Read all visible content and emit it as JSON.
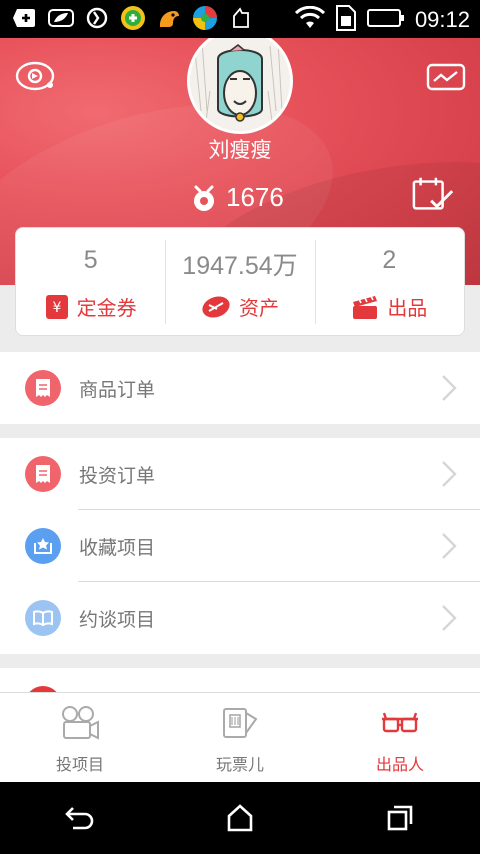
{
  "status_bar": {
    "time": "09:12"
  },
  "profile": {
    "username": "刘瘦瘦",
    "coins": "1676"
  },
  "stats": [
    {
      "value": "5",
      "label": "定金券",
      "icon": "coupon-icon"
    },
    {
      "value": "1947.54万",
      "label": "资产",
      "icon": "assets-icon"
    },
    {
      "value": "2",
      "label": "出品",
      "icon": "clapper-icon"
    }
  ],
  "menu": {
    "group1": [
      {
        "label": "商品订单",
        "icon": "receipt-icon",
        "color": "#f0656c"
      }
    ],
    "group2": [
      {
        "label": "投资订单",
        "icon": "receipt-icon",
        "color": "#f0656c"
      },
      {
        "label": "收藏项目",
        "icon": "star-box-icon",
        "color": "#5a9ff0"
      },
      {
        "label": "约谈项目",
        "icon": "book-icon",
        "color": "#9cc4f3"
      }
    ]
  },
  "tabs": [
    {
      "label": "投项目",
      "icon": "camera-icon",
      "active": false
    },
    {
      "label": "玩票儿",
      "icon": "ticket-icon",
      "active": false
    },
    {
      "label": "出品人",
      "icon": "3d-glasses-icon",
      "active": true
    }
  ],
  "colors": {
    "accent": "#e4393c",
    "header": "#e8525b"
  }
}
